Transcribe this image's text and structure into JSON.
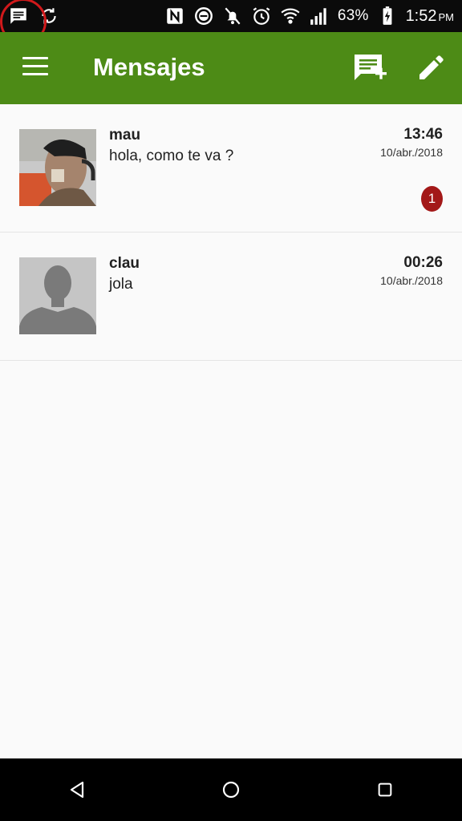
{
  "status_bar": {
    "battery": "63%",
    "time": "1:52",
    "time_suffix": "PM",
    "icons": [
      "message-icon",
      "sync-icon",
      "nfc-icon",
      "do-not-disturb-icon",
      "notifications-off-icon",
      "alarm-icon",
      "wifi-icon",
      "signal-icon",
      "battery-charging-icon"
    ]
  },
  "app_bar": {
    "title": "Mensajes",
    "color": "#4d8b16",
    "actions": [
      "new-message-icon",
      "edit-icon"
    ]
  },
  "conversations": [
    {
      "name": "mau",
      "snippet": "hola, como te va ?",
      "time": "13:46",
      "date": "10/abr./2018",
      "unread": "1",
      "avatar": "photo"
    },
    {
      "name": "clau",
      "snippet": "jola",
      "time": "00:26",
      "date": "10/abr./2018",
      "avatar": "default-silhouette"
    }
  ],
  "nav_bar": {
    "buttons": [
      "back-icon",
      "home-icon",
      "recents-icon"
    ]
  }
}
